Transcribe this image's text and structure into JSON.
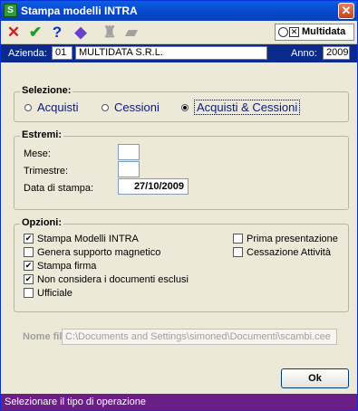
{
  "window": {
    "title": "Stampa modelli INTRA",
    "app_icon_glyph": "S",
    "close_glyph": "✕"
  },
  "toolbar": {
    "icons": [
      {
        "name": "cancel-icon",
        "glyph": "✕",
        "color": "#d02020"
      },
      {
        "name": "confirm-icon",
        "glyph": "✔",
        "color": "#1e9e1e"
      },
      {
        "name": "help-icon",
        "glyph": "?",
        "color": "#1030c0"
      },
      {
        "name": "tag-icon",
        "glyph": "◆",
        "color": "#6a3fc9"
      },
      {
        "name": "binoculars-icon",
        "glyph": "♜",
        "color": "#a0a0a0"
      },
      {
        "name": "folder-icon",
        "glyph": "▰",
        "color": "#a0a0a0"
      }
    ],
    "logo_text": "Multidata"
  },
  "infobar": {
    "azienda_label": "Azienda:",
    "azienda_code": "01",
    "azienda_name": "MULTIDATA S.R.L.",
    "anno_label": "Anno:",
    "anno_value": "2009"
  },
  "selezione": {
    "title": "Selezione:",
    "options": [
      {
        "label": "Acquisti",
        "checked": false
      },
      {
        "label": "Cessioni",
        "checked": false
      },
      {
        "label": "Acquisti & Cessioni",
        "checked": true
      }
    ]
  },
  "estremi": {
    "title": "Estremi:",
    "mese_label": "Mese:",
    "mese_value": "",
    "trimestre_label": "Trimestre:",
    "trimestre_value": "",
    "data_label": "Data di stampa:",
    "data_value": "27/10/2009"
  },
  "opzioni": {
    "title": "Opzioni:",
    "check_glyph": "✔",
    "left": [
      {
        "label": "Stampa Modelli INTRA",
        "checked": true
      },
      {
        "label": "Genera supporto magnetico",
        "checked": false
      },
      {
        "label": "Stampa firma",
        "checked": true
      },
      {
        "label": "Non considera i documenti esclusi",
        "checked": true
      },
      {
        "label": "Ufficiale",
        "checked": false
      }
    ],
    "right": [
      {
        "label": "Prima presentazione",
        "checked": false
      },
      {
        "label": "Cessazione Attività",
        "checked": false
      }
    ]
  },
  "nome_file": {
    "label": "Nome file:",
    "value": "C:\\Documents and Settings\\simoned\\Documenti\\scambi.cee"
  },
  "ok_label": "Ok",
  "status": "Selezionare il tipo di operazione"
}
